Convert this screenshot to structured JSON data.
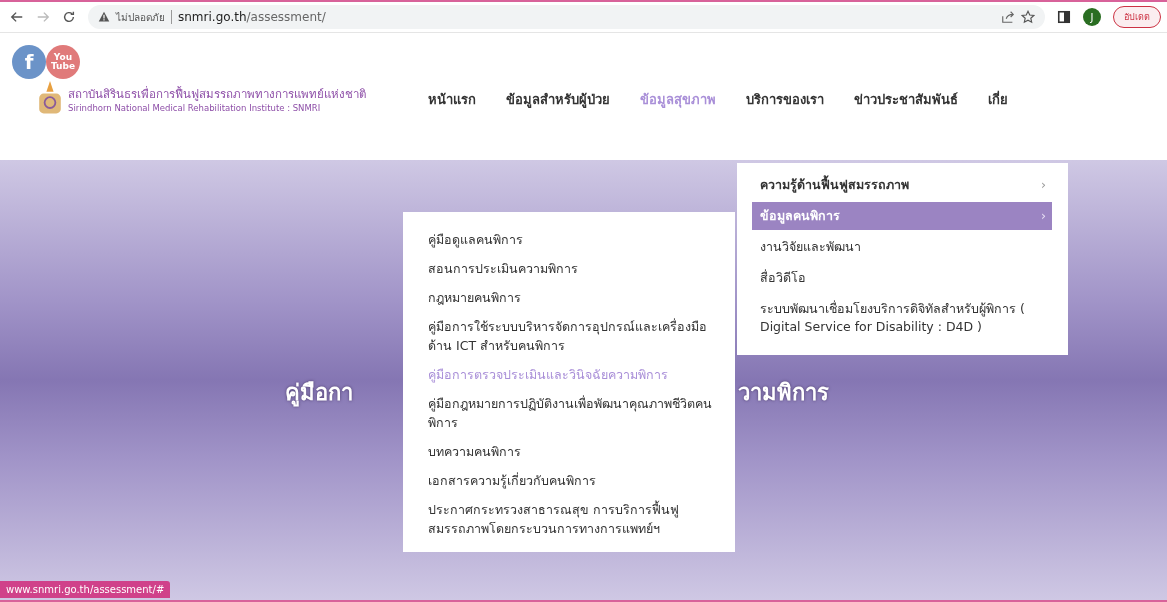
{
  "browser": {
    "security_label": "ไม่ปลอดภัย",
    "url_host": "snmri.go.th",
    "url_path": "/assessment/",
    "profile_initial": "J",
    "update_button": "อัปเดต",
    "forward_disabled": true
  },
  "header": {
    "logo_title": "สถาบันสิรินธรเพื่อการฟื้นฟูสมรรถภาพทางการแพทย์แห่งชาติ",
    "logo_subtitle": "Sirindhorn National Medical Rehabilitation Institute : SNMRI",
    "social": [
      {
        "kind": "facebook",
        "label": "f"
      },
      {
        "kind": "youtube",
        "label": "You Tube"
      }
    ],
    "nav": [
      {
        "label": "หน้าแรก",
        "selected": false
      },
      {
        "label": "ข้อมูลสำหรับผู้ป่วย",
        "selected": false
      },
      {
        "label": "ข้อมูลสุขภาพ",
        "selected": true
      },
      {
        "label": "บริการของเรา",
        "selected": false
      },
      {
        "label": "ข่าวประชาสัมพันธ์",
        "selected": false
      },
      {
        "label": "เกี่ย",
        "selected": false
      }
    ]
  },
  "hero": {
    "title_left": "คู่มือกา",
    "title_right": "วามพิการ"
  },
  "menu": {
    "items": [
      {
        "label": "ความรู้ด้านฟื้นฟูสมรรถภาพ",
        "arrow": "›",
        "selected": false
      },
      {
        "label": "ข้อมูลคนพิการ",
        "arrow": "›",
        "selected": true
      },
      {
        "label": "งานวิจัยและพัฒนา",
        "selected": false
      },
      {
        "label": "สื่อวิดีโอ",
        "selected": false
      },
      {
        "label": "ระบบพัฒนาเชื่อมโยงบริการดิจิทัลสำหรับผู้พิการ ( Digital Service for Disability : D4D )",
        "selected": false
      }
    ]
  },
  "submenu": {
    "items": [
      {
        "label": "คู่มือดูแลคนพิการ",
        "selected": false
      },
      {
        "label": "สอนการประเมินความพิการ",
        "selected": false
      },
      {
        "label": "กฎหมายคนพิการ",
        "selected": false
      },
      {
        "label": "คู่มือการใช้ระบบบริหารจัดการอุปกรณ์และเครื่องมือด้าน ICT สำหรับคนพิการ",
        "selected": false
      },
      {
        "label": "คู่มือการตรวจประเมินและวินิจฉัยความพิการ",
        "selected": true
      },
      {
        "label": "คู่มือกฎหมายการปฏิบัติงานเพื่อพัฒนาคุณภาพชีวิตคนพิการ",
        "selected": false
      },
      {
        "label": "บทความคนพิการ",
        "selected": false
      },
      {
        "label": "เอกสารความรู้เกี่ยวกับคนพิการ",
        "selected": false
      },
      {
        "label": "ประกาศกระทรวงสาธารณสุข การบริการฟื้นฟูสมรรถภาพโดยกระบวนการทางการแพทย์ฯ",
        "selected": false
      }
    ]
  },
  "status_bar": {
    "url": "www.snmri.go.th/assessment/#"
  }
}
